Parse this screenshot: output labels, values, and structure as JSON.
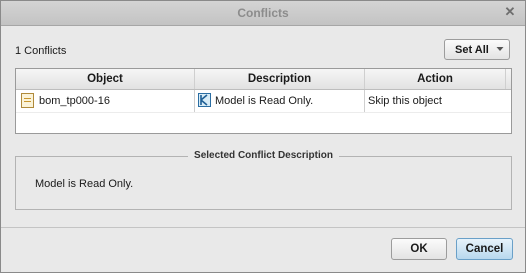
{
  "window": {
    "title": "Conflicts",
    "close_glyph": "✕"
  },
  "toolbar": {
    "count_label": "1 Conflicts",
    "set_all_label": "Set All"
  },
  "table": {
    "columns": [
      "Object",
      "Description",
      "Action"
    ],
    "rows": [
      {
        "object": "bom_tp000-16",
        "object_icon": "document-icon",
        "description": "Model is Read Only.",
        "description_icon": "read-only-model-icon",
        "action": "Skip this object"
      }
    ]
  },
  "conflict_group": {
    "title": "Selected Conflict Description",
    "text": "Model is Read Only."
  },
  "buttons": {
    "ok_label": "OK",
    "cancel_label": "Cancel"
  },
  "colors": {
    "accent": "#b8d8ee",
    "window_bg": "#e9e9e9",
    "titlebar_text": "#8c8c8c"
  }
}
